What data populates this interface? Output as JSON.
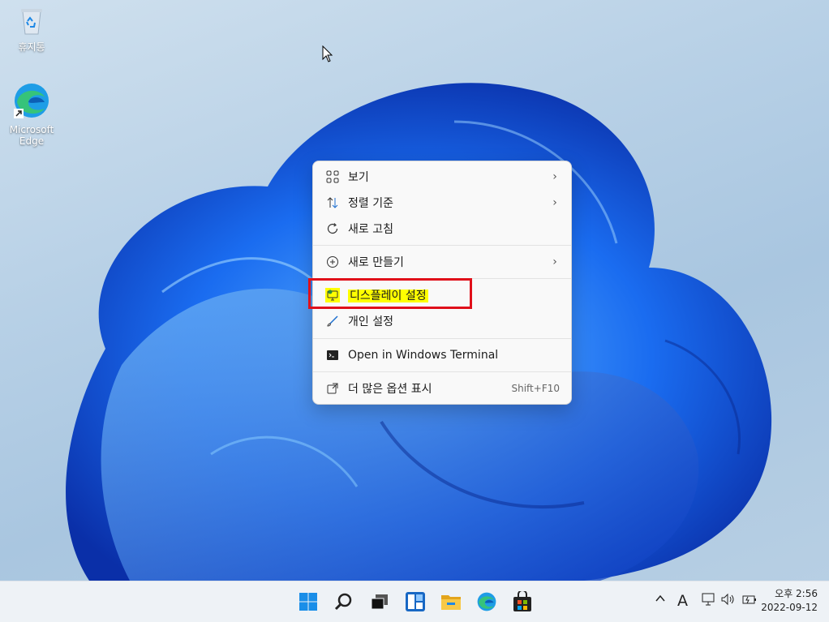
{
  "desktop": {
    "icons": [
      {
        "label": "휴지통",
        "icon": "recycle-bin-icon"
      },
      {
        "label": "Microsoft Edge",
        "icon": "edge-icon"
      }
    ]
  },
  "context_menu": {
    "items": [
      {
        "label": "보기",
        "icon": "grid-view-icon",
        "has_submenu": true
      },
      {
        "label": "정렬 기준",
        "icon": "sort-icon",
        "has_submenu": true
      },
      {
        "label": "새로 고침",
        "icon": "refresh-icon"
      },
      {
        "label": "새로 만들기",
        "icon": "new-plus-icon",
        "has_submenu": true
      },
      {
        "label": "디스플레이 설정",
        "icon": "display-settings-icon",
        "highlighted": true
      },
      {
        "label": "개인 설정",
        "icon": "personalize-brush-icon"
      },
      {
        "label": "Open in Windows Terminal",
        "icon": "terminal-icon"
      },
      {
        "label": "더 많은 옵션 표시",
        "icon": "more-options-icon",
        "shortcut": "Shift+F10"
      }
    ],
    "highlight_color": "#ffff00",
    "annotation_color": "#e0101a"
  },
  "taskbar": {
    "apps": [
      "start-icon",
      "search-icon",
      "task-view-icon",
      "widgets-icon",
      "file-explorer-icon",
      "edge-icon",
      "store-icon"
    ],
    "tray": {
      "input_indicator": "A"
    },
    "clock": {
      "time": "오후 2:56",
      "date": "2022-09-12"
    }
  }
}
